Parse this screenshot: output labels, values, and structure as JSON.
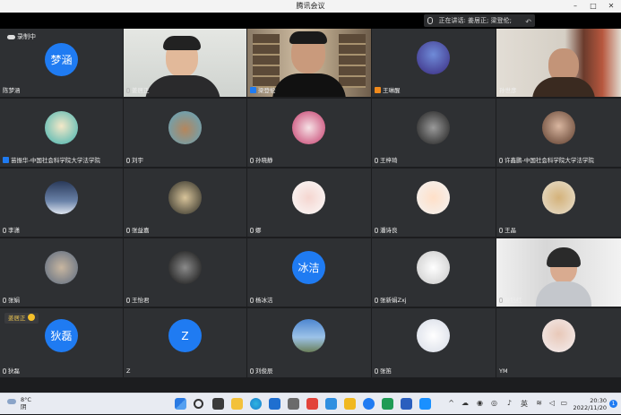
{
  "window": {
    "title": "腾讯会议",
    "controls": [
      "–",
      "□",
      "✕"
    ]
  },
  "speaking_banner": {
    "text": "正在讲话: 姜居正; 梁登伦;"
  },
  "recording": {
    "label": "录制中"
  },
  "reaction": {
    "name": "姜居正"
  },
  "participants": [
    {
      "name": "陈梦涵",
      "avatar": "梦涵",
      "kind": "text"
    },
    {
      "name": "姜居正",
      "kind": "video",
      "icon": "mic"
    },
    {
      "name": "梁登伦",
      "kind": "video",
      "icon": "host"
    },
    {
      "name": "王琳醒",
      "kind": "photo",
      "icon": "cohost"
    },
    {
      "name": "孙世彦",
      "kind": "video"
    },
    {
      "name": "苗振华-中国社会科学院大学法学院",
      "kind": "photo",
      "icon": "host"
    },
    {
      "name": "刘宇",
      "kind": "photo"
    },
    {
      "name": "孙晓静",
      "kind": "photo"
    },
    {
      "name": "王梓琦",
      "kind": "photo"
    },
    {
      "name": "许鑫鹏-中国社会科学院大学法学院",
      "kind": "photo"
    },
    {
      "name": "李潇",
      "kind": "photo"
    },
    {
      "name": "张益嘉",
      "kind": "photo"
    },
    {
      "name": "娜",
      "kind": "photo"
    },
    {
      "name": "潘诗良",
      "kind": "photo"
    },
    {
      "name": "王晶",
      "kind": "photo"
    },
    {
      "name": "张娟",
      "kind": "photo"
    },
    {
      "name": "王怡君",
      "kind": "photo"
    },
    {
      "name": "杨冰洁",
      "avatar": "冰洁",
      "kind": "text"
    },
    {
      "name": "张新娟Zxj",
      "kind": "photo"
    },
    {
      "name": "戴钰红",
      "kind": "video"
    },
    {
      "name": "狄磊",
      "avatar": "狄磊",
      "kind": "text"
    },
    {
      "name": "Z",
      "avatar": "Z",
      "kind": "text"
    },
    {
      "name": "刘俊辰",
      "kind": "photo"
    },
    {
      "name": "张笛",
      "kind": "photo"
    },
    {
      "name": "YM",
      "kind": "photo"
    }
  ],
  "taskbar": {
    "weather_temp": "8°C",
    "weather_desc": "阴",
    "time": "20:30",
    "date": "2022/11/20",
    "ime": "英",
    "notifications": "1"
  },
  "colors": {
    "accent": "#1f7bf2",
    "tile_bg": "#2e3033",
    "background": "#1c1d1f"
  }
}
